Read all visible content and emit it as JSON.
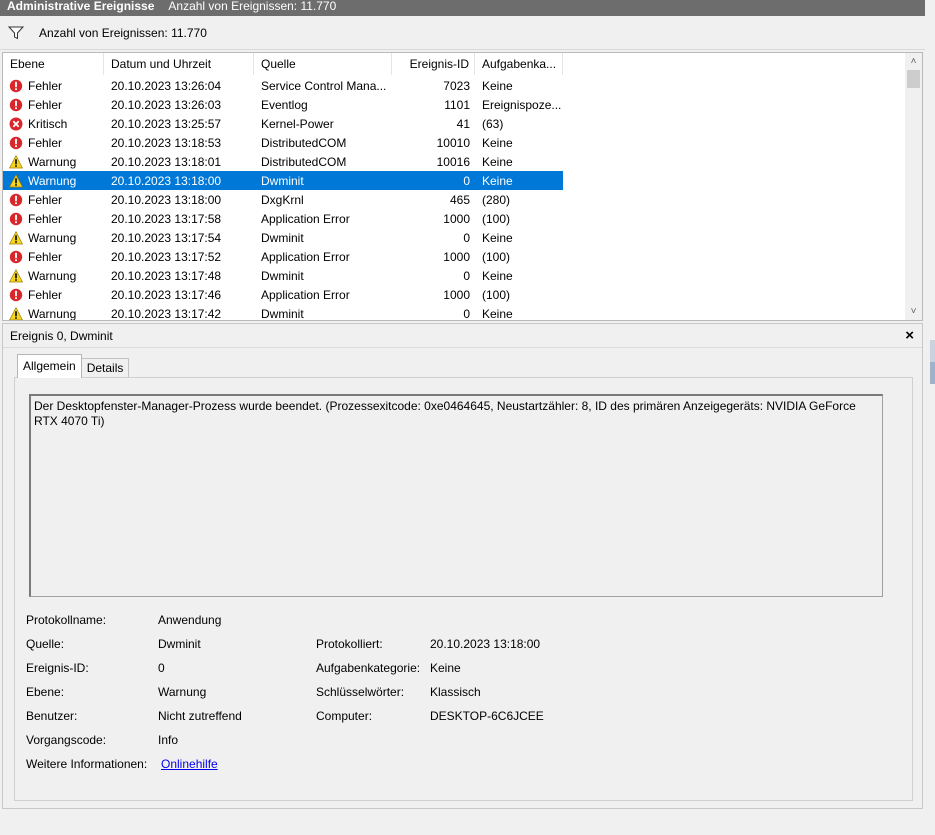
{
  "header": {
    "title": "Administrative Ereignisse",
    "count": "Anzahl von Ereignissen: 11.770"
  },
  "filter": {
    "text": "Anzahl von Ereignissen: 11.770",
    "icon": "filter-icon"
  },
  "columns": [
    "Ebene",
    "Datum und Uhrzeit",
    "Quelle",
    "Ereignis-ID",
    "Aufgabenka..."
  ],
  "events": [
    {
      "level": "Fehler",
      "icon": "error",
      "date": "20.10.2023 13:26:04",
      "source": "Service Control Mana...",
      "id": "7023",
      "task": "Keine"
    },
    {
      "level": "Fehler",
      "icon": "error",
      "date": "20.10.2023 13:26:03",
      "source": "Eventlog",
      "id": "1101",
      "task": "Ereignispoze..."
    },
    {
      "level": "Kritisch",
      "icon": "critical",
      "date": "20.10.2023 13:25:57",
      "source": "Kernel-Power",
      "id": "41",
      "task": "(63)"
    },
    {
      "level": "Fehler",
      "icon": "error",
      "date": "20.10.2023 13:18:53",
      "source": "DistributedCOM",
      "id": "10010",
      "task": "Keine"
    },
    {
      "level": "Warnung",
      "icon": "warning",
      "date": "20.10.2023 13:18:01",
      "source": "DistributedCOM",
      "id": "10016",
      "task": "Keine"
    },
    {
      "level": "Warnung",
      "icon": "warning",
      "date": "20.10.2023 13:18:00",
      "source": "Dwminit",
      "id": "0",
      "task": "Keine",
      "selected": true
    },
    {
      "level": "Fehler",
      "icon": "error",
      "date": "20.10.2023 13:18:00",
      "source": "DxgKrnl",
      "id": "465",
      "task": "(280)"
    },
    {
      "level": "Fehler",
      "icon": "error",
      "date": "20.10.2023 13:17:58",
      "source": "Application Error",
      "id": "1000",
      "task": "(100)"
    },
    {
      "level": "Warnung",
      "icon": "warning",
      "date": "20.10.2023 13:17:54",
      "source": "Dwminit",
      "id": "0",
      "task": "Keine"
    },
    {
      "level": "Fehler",
      "icon": "error",
      "date": "20.10.2023 13:17:52",
      "source": "Application Error",
      "id": "1000",
      "task": "(100)"
    },
    {
      "level": "Warnung",
      "icon": "warning",
      "date": "20.10.2023 13:17:48",
      "source": "Dwminit",
      "id": "0",
      "task": "Keine"
    },
    {
      "level": "Fehler",
      "icon": "error",
      "date": "20.10.2023 13:17:46",
      "source": "Application Error",
      "id": "1000",
      "task": "(100)"
    },
    {
      "level": "Warnung",
      "icon": "warning",
      "date": "20.10.2023 13:17:42",
      "source": "Dwminit",
      "id": "0",
      "task": "Keine"
    }
  ],
  "detail": {
    "title": "Ereignis 0, Dwminit",
    "close": "×",
    "tabs": [
      "Allgemein",
      "Details"
    ],
    "message": "Der Desktopfenster-Manager-Prozess wurde beendet. (Prozessexitcode: 0xe0464645, Neustartzähler: 8, ID des primären Anzeigegeräts: NVIDIA GeForce RTX 4070 Ti)",
    "labels": {
      "protokollname": "Protokollname:",
      "quelle": "Quelle:",
      "ereignis_id": "Ereignis-ID:",
      "ebene": "Ebene:",
      "benutzer": "Benutzer:",
      "vorgangscode": "Vorgangscode:",
      "weitere": "Weitere Informationen:",
      "protokolliert": "Protokolliert:",
      "aufgabenkategorie": "Aufgabenkategorie:",
      "schluesselwoerter": "Schlüsselwörter:",
      "computer": "Computer:"
    },
    "values": {
      "protokollname": "Anwendung",
      "quelle": "Dwminit",
      "ereignis_id": "0",
      "ebene": "Warnung",
      "benutzer": "Nicht zutreffend",
      "vorgangscode": "Info",
      "weitere": "Onlinehilfe",
      "protokolliert": "20.10.2023 13:18:00",
      "aufgabenkategorie": "Keine",
      "schluesselwoerter": "Klassisch",
      "computer": "DESKTOP-6C6JCEE"
    }
  }
}
